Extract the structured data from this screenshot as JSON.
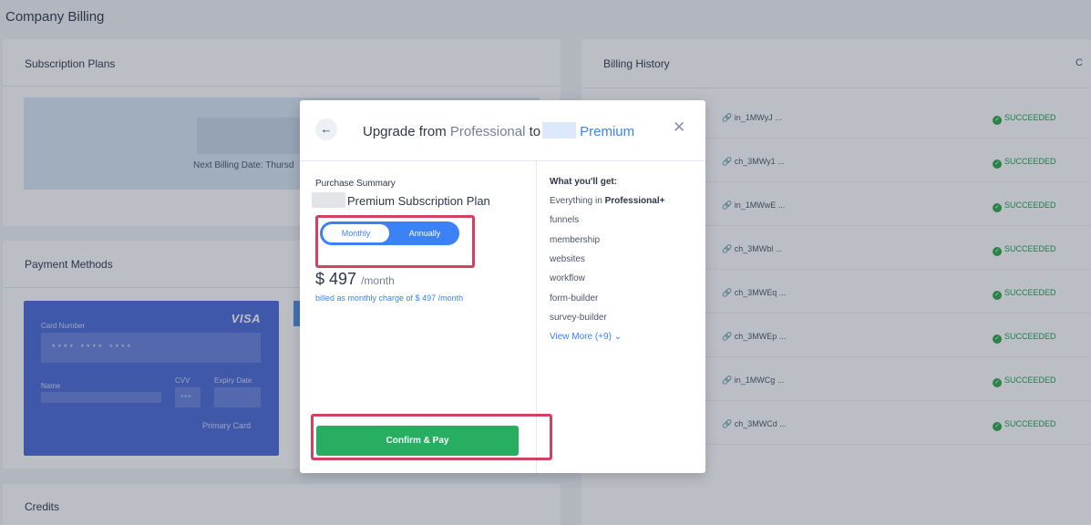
{
  "page": {
    "title": "Company Billing"
  },
  "subscription": {
    "heading": "Subscription Plans",
    "next_billing": "Next Billing Date: Thursd"
  },
  "payment_methods": {
    "heading": "Payment Methods",
    "card_brand": "VISA",
    "card_number_label": "Card Number",
    "card_number_masked": "****   ****   ****",
    "name_label": "Name",
    "cvv_label": "CVV",
    "cvv_masked": "***",
    "expiry_label": "Expiry Date",
    "primary_label": "Primary Card"
  },
  "credits": {
    "heading": "Credits"
  },
  "billing_history": {
    "heading": "Billing History",
    "refresh_icon": "C",
    "rows": [
      {
        "id": "in_1MWyJ ...",
        "status": "SUCCEEDED"
      },
      {
        "id": "ch_3MWy1 ...",
        "status": "SUCCEEDED"
      },
      {
        "id": "in_1MWwE ...",
        "status": "SUCCEEDED"
      },
      {
        "id": "ch_3MWbl ...",
        "status": "SUCCEEDED"
      },
      {
        "id": "ch_3MWEq ...",
        "status": "SUCCEEDED"
      },
      {
        "id": "ch_3MWEp ...",
        "status": "SUCCEEDED"
      },
      {
        "id": "in_1MWCg ...",
        "status": "SUCCEEDED"
      },
      {
        "id": "ch_3MWCd ...",
        "status": "SUCCEEDED"
      }
    ]
  },
  "modal": {
    "title_prefix": "Upgrade from",
    "from_plan": "Professional",
    "to_word": "to",
    "to_plan": "Premium",
    "purchase_summary_label": "Purchase Summary",
    "plan_name": "Premium Subscription Plan",
    "toggle": {
      "monthly": "Monthly",
      "annually": "Annually",
      "selected": "Annually"
    },
    "price": "$ 497",
    "price_period": "/month",
    "billed_note": "billed as monthly charge of $ 497 /month",
    "confirm_label": "Confirm & Pay",
    "what_you_get_title": "What you'll get:",
    "features_lead": "Everything in",
    "features_lead_bold": "Professional+",
    "features": [
      "funnels",
      "membership",
      "websites",
      "workflow",
      "form-builder",
      "survey-builder"
    ],
    "view_more": "View More (+9)"
  },
  "colors": {
    "accent": "#3b82f6",
    "confirm": "#27ae60",
    "success": "#28a745",
    "highlight": "#d1425d",
    "card": "#4a69d6"
  }
}
